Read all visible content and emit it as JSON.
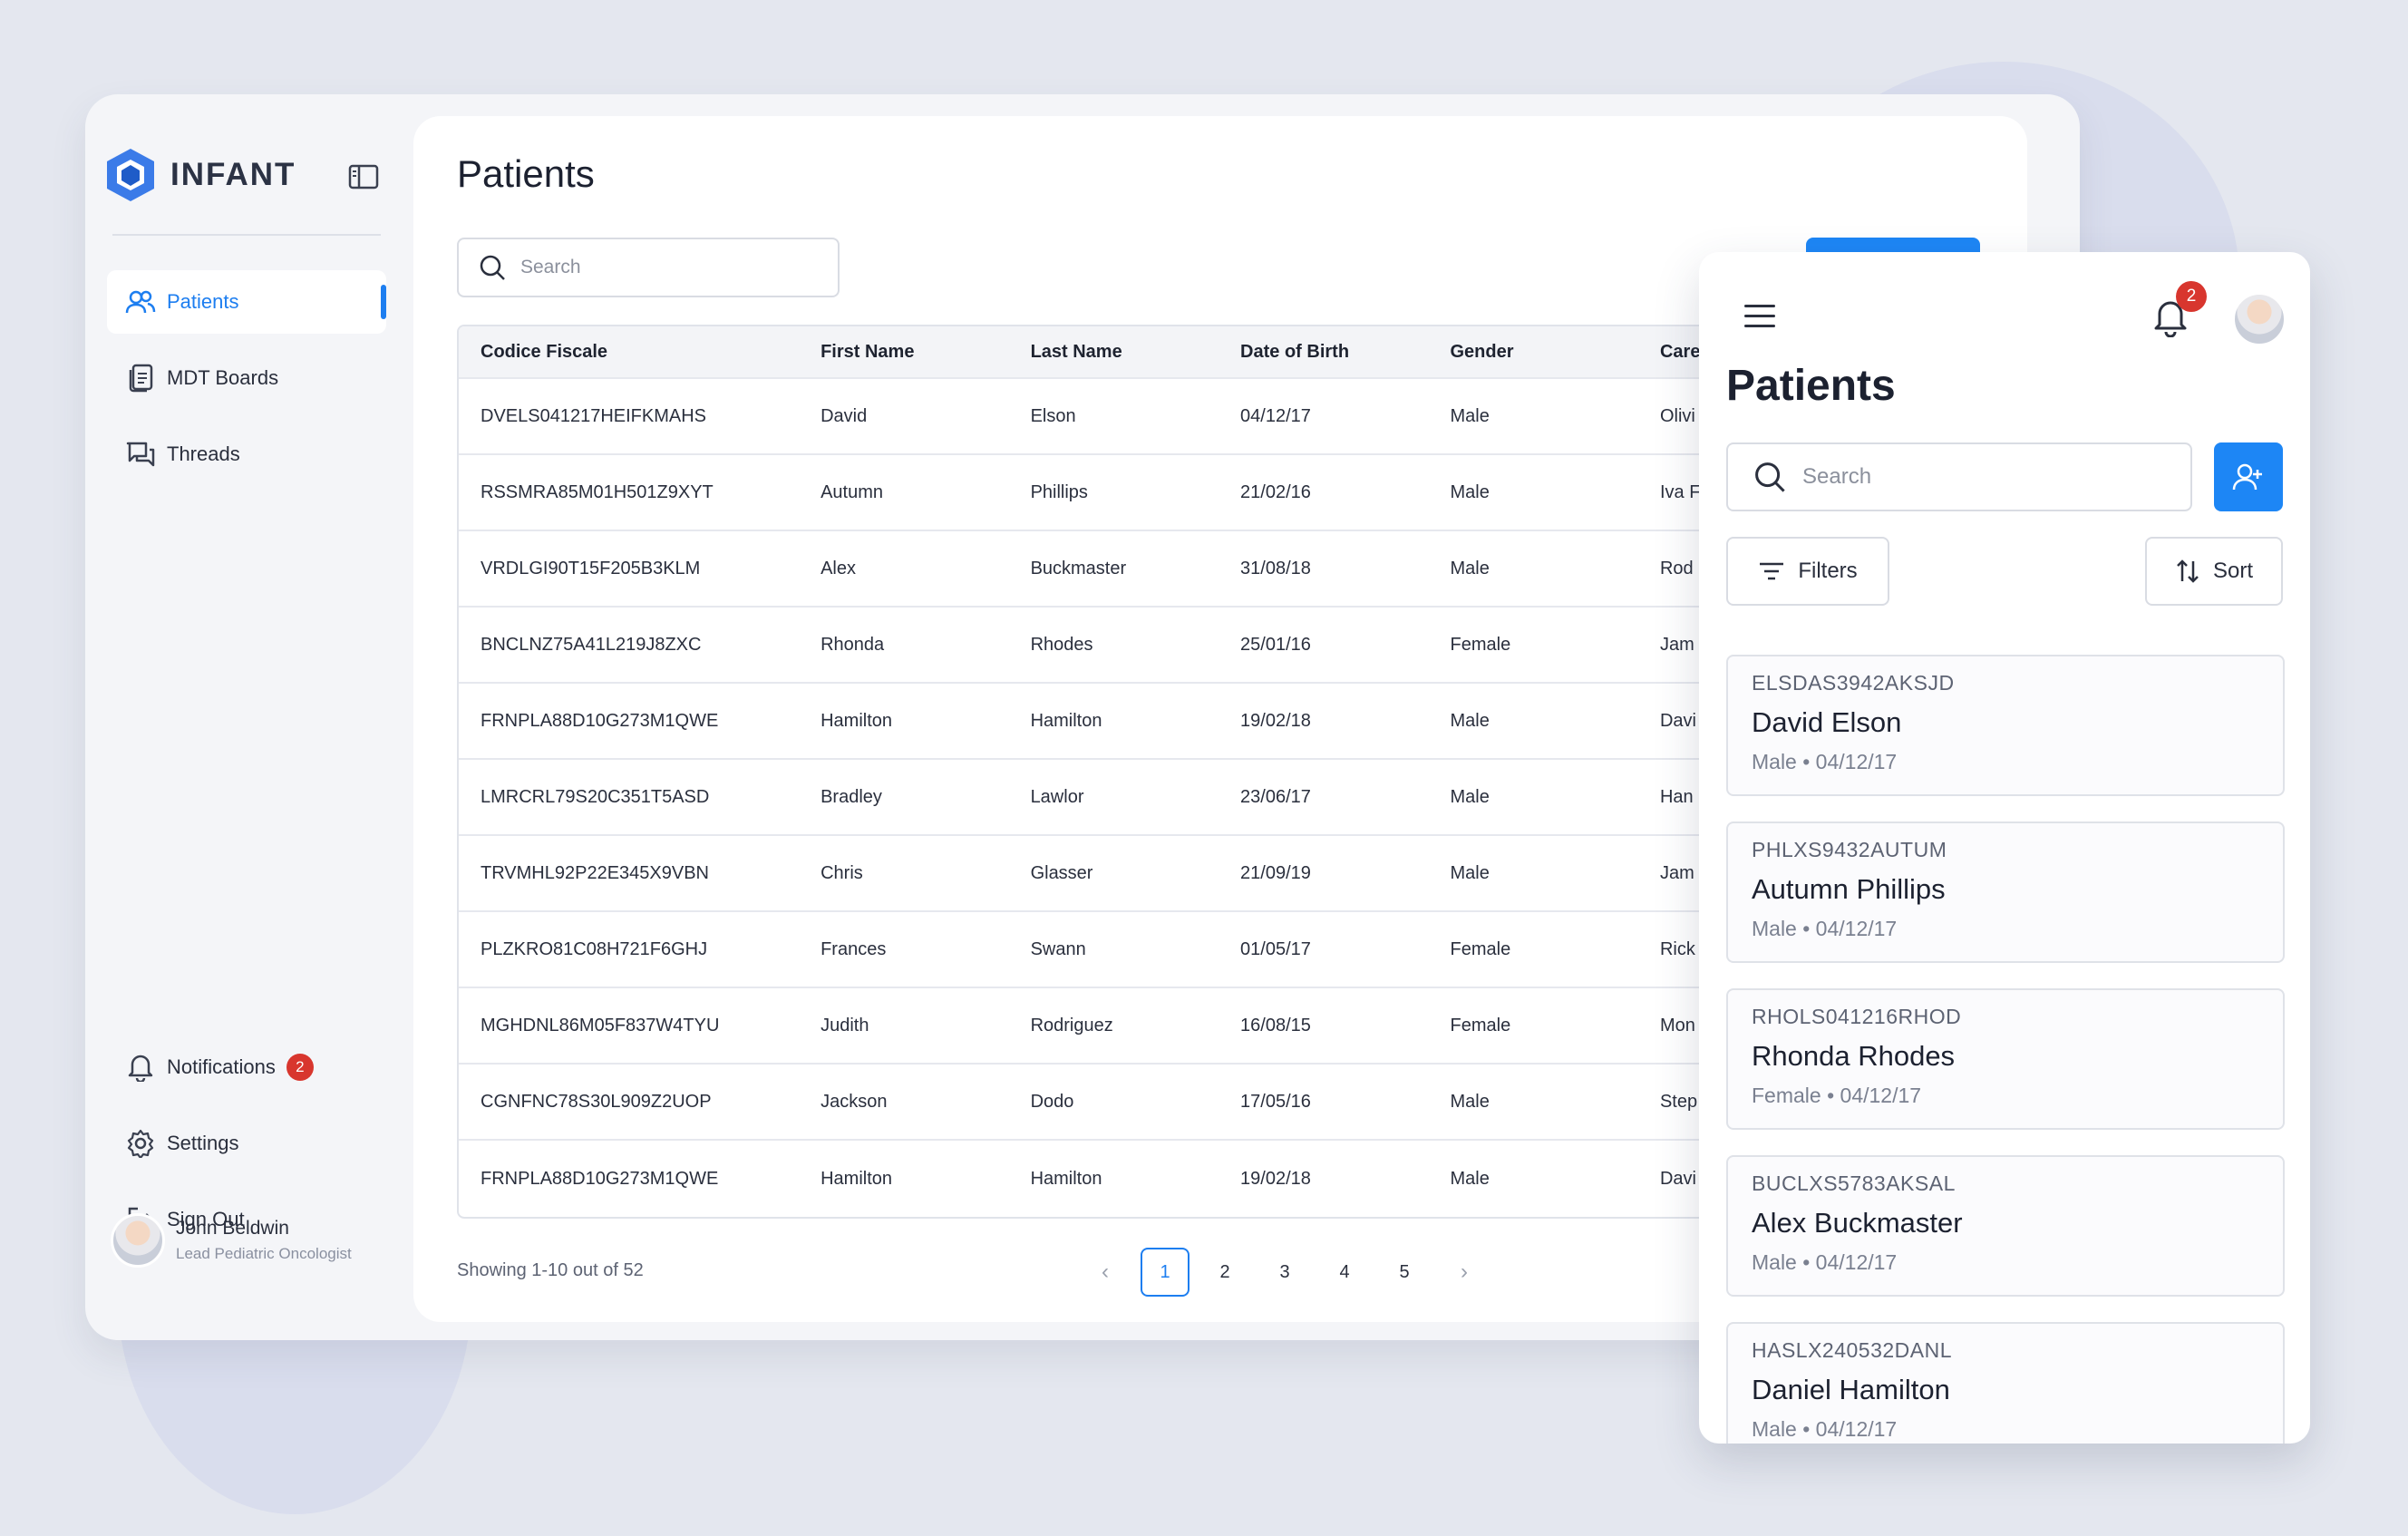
{
  "app": {
    "name": "INFANT"
  },
  "sidebar": {
    "nav": [
      {
        "label": "Patients",
        "icon": "users-icon",
        "active": true
      },
      {
        "label": "MDT Boards",
        "icon": "document-icon",
        "active": false
      },
      {
        "label": "Threads",
        "icon": "chat-icon",
        "active": false
      }
    ],
    "bottom": [
      {
        "label": "Notifications",
        "icon": "bell-icon",
        "badge": "2"
      },
      {
        "label": "Settings",
        "icon": "gear-icon"
      },
      {
        "label": "Sign Out",
        "icon": "sign-out-icon"
      }
    ],
    "user": {
      "name": "John Beldwin",
      "role": "Lead Pediatric Oncologist"
    }
  },
  "main": {
    "title": "Patients",
    "search_placeholder": "Search",
    "table": {
      "columns": [
        "Codice Fiscale",
        "First Name",
        "Last Name",
        "Date of Birth",
        "Gender",
        "Care"
      ],
      "rows": [
        [
          "DVELS041217HEIFKMAHS",
          "David",
          "Elson",
          "04/12/17",
          "Male",
          "Olivi"
        ],
        [
          "RSSMRA85M01H501Z9XYT",
          "Autumn",
          "Phillips",
          "21/02/16",
          "Male",
          "Iva F"
        ],
        [
          "VRDLGI90T15F205B3KLM",
          "Alex",
          "Buckmaster",
          "31/08/18",
          "Male",
          "Rod"
        ],
        [
          "BNCLNZ75A41L219J8ZXC",
          "Rhonda",
          "Rhodes",
          "25/01/16",
          "Female",
          "Jam"
        ],
        [
          "FRNPLA88D10G273M1QWE",
          "Hamilton",
          "Hamilton",
          "19/02/18",
          "Male",
          "Davi"
        ],
        [
          "LMRCRL79S20C351T5ASD",
          "Bradley",
          "Lawlor",
          "23/06/17",
          "Male",
          "Han"
        ],
        [
          "TRVMHL92P22E345X9VBN",
          "Chris",
          "Glasser",
          "21/09/19",
          "Male",
          "Jam"
        ],
        [
          "PLZKRO81C08H721F6GHJ",
          "Frances",
          "Swann",
          "01/05/17",
          "Female",
          "Rick"
        ],
        [
          "MGHDNL86M05F837W4TYU",
          "Judith",
          "Rodriguez",
          "16/08/15",
          "Female",
          "Mon"
        ],
        [
          "CGNFNC78S30L909Z2UOP",
          "Jackson",
          "Dodo",
          "17/05/16",
          "Male",
          "Step"
        ],
        [
          "FRNPLA88D10G273M1QWE",
          "Hamilton",
          "Hamilton",
          "19/02/18",
          "Male",
          "Davi"
        ]
      ]
    },
    "showing": "Showing 1-10 out of 52",
    "pages": [
      "1",
      "2",
      "3",
      "4",
      "5"
    ],
    "current_page": "1",
    "prev_icon": "chevron-left-icon",
    "next_icon": "chevron-right-icon"
  },
  "mobile": {
    "title": "Patients",
    "notification_badge": "2",
    "search_placeholder": "Search",
    "filters_label": "Filters",
    "sort_label": "Sort",
    "cards": [
      {
        "code": "ELSDAS3942AKSJD",
        "name": "David Elson",
        "meta": "Male  •  04/12/17"
      },
      {
        "code": "PHLXS9432AUTUM",
        "name": "Autumn Phillips",
        "meta": "Male  •  04/12/17"
      },
      {
        "code": "RHOLS041216RHOD",
        "name": "Rhonda Rhodes",
        "meta": "Female  •  04/12/17"
      },
      {
        "code": "BUCLXS5783AKSAL",
        "name": "Alex Buckmaster",
        "meta": "Male  •  04/12/17"
      },
      {
        "code": "HASLX240532DANL",
        "name": "Daniel Hamilton",
        "meta": "Male  •  04/12/17"
      }
    ]
  },
  "colors": {
    "accent": "#1d86f5",
    "badge": "#d8362e",
    "background": "#e4e7ef"
  }
}
